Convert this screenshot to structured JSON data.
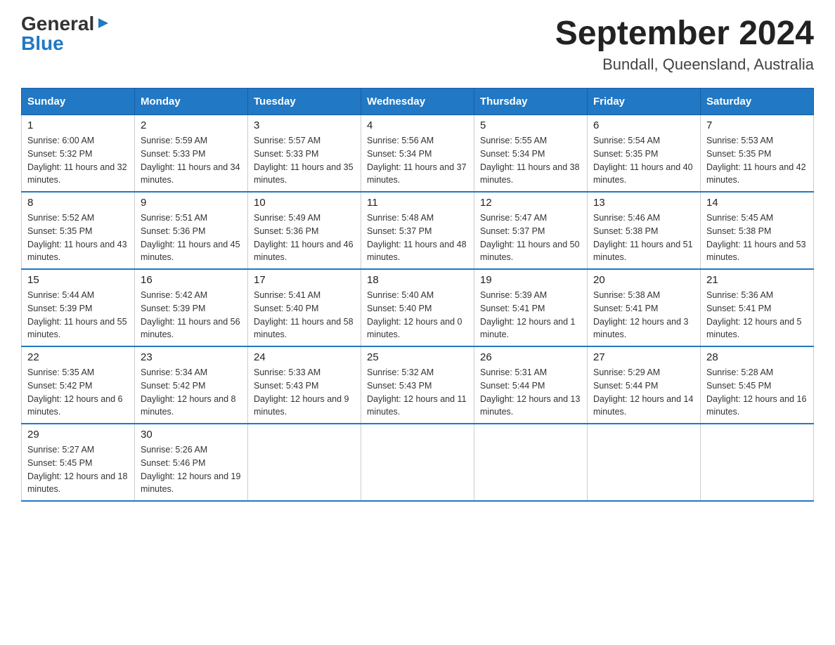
{
  "header": {
    "logo_general": "General",
    "logo_blue": "Blue",
    "month_title": "September 2024",
    "location": "Bundall, Queensland, Australia"
  },
  "days_of_week": [
    "Sunday",
    "Monday",
    "Tuesday",
    "Wednesday",
    "Thursday",
    "Friday",
    "Saturday"
  ],
  "weeks": [
    [
      {
        "day": "1",
        "sunrise": "6:00 AM",
        "sunset": "5:32 PM",
        "daylight": "11 hours and 32 minutes."
      },
      {
        "day": "2",
        "sunrise": "5:59 AM",
        "sunset": "5:33 PM",
        "daylight": "11 hours and 34 minutes."
      },
      {
        "day": "3",
        "sunrise": "5:57 AM",
        "sunset": "5:33 PM",
        "daylight": "11 hours and 35 minutes."
      },
      {
        "day": "4",
        "sunrise": "5:56 AM",
        "sunset": "5:34 PM",
        "daylight": "11 hours and 37 minutes."
      },
      {
        "day": "5",
        "sunrise": "5:55 AM",
        "sunset": "5:34 PM",
        "daylight": "11 hours and 38 minutes."
      },
      {
        "day": "6",
        "sunrise": "5:54 AM",
        "sunset": "5:35 PM",
        "daylight": "11 hours and 40 minutes."
      },
      {
        "day": "7",
        "sunrise": "5:53 AM",
        "sunset": "5:35 PM",
        "daylight": "11 hours and 42 minutes."
      }
    ],
    [
      {
        "day": "8",
        "sunrise": "5:52 AM",
        "sunset": "5:35 PM",
        "daylight": "11 hours and 43 minutes."
      },
      {
        "day": "9",
        "sunrise": "5:51 AM",
        "sunset": "5:36 PM",
        "daylight": "11 hours and 45 minutes."
      },
      {
        "day": "10",
        "sunrise": "5:49 AM",
        "sunset": "5:36 PM",
        "daylight": "11 hours and 46 minutes."
      },
      {
        "day": "11",
        "sunrise": "5:48 AM",
        "sunset": "5:37 PM",
        "daylight": "11 hours and 48 minutes."
      },
      {
        "day": "12",
        "sunrise": "5:47 AM",
        "sunset": "5:37 PM",
        "daylight": "11 hours and 50 minutes."
      },
      {
        "day": "13",
        "sunrise": "5:46 AM",
        "sunset": "5:38 PM",
        "daylight": "11 hours and 51 minutes."
      },
      {
        "day": "14",
        "sunrise": "5:45 AM",
        "sunset": "5:38 PM",
        "daylight": "11 hours and 53 minutes."
      }
    ],
    [
      {
        "day": "15",
        "sunrise": "5:44 AM",
        "sunset": "5:39 PM",
        "daylight": "11 hours and 55 minutes."
      },
      {
        "day": "16",
        "sunrise": "5:42 AM",
        "sunset": "5:39 PM",
        "daylight": "11 hours and 56 minutes."
      },
      {
        "day": "17",
        "sunrise": "5:41 AM",
        "sunset": "5:40 PM",
        "daylight": "11 hours and 58 minutes."
      },
      {
        "day": "18",
        "sunrise": "5:40 AM",
        "sunset": "5:40 PM",
        "daylight": "12 hours and 0 minutes."
      },
      {
        "day": "19",
        "sunrise": "5:39 AM",
        "sunset": "5:41 PM",
        "daylight": "12 hours and 1 minute."
      },
      {
        "day": "20",
        "sunrise": "5:38 AM",
        "sunset": "5:41 PM",
        "daylight": "12 hours and 3 minutes."
      },
      {
        "day": "21",
        "sunrise": "5:36 AM",
        "sunset": "5:41 PM",
        "daylight": "12 hours and 5 minutes."
      }
    ],
    [
      {
        "day": "22",
        "sunrise": "5:35 AM",
        "sunset": "5:42 PM",
        "daylight": "12 hours and 6 minutes."
      },
      {
        "day": "23",
        "sunrise": "5:34 AM",
        "sunset": "5:42 PM",
        "daylight": "12 hours and 8 minutes."
      },
      {
        "day": "24",
        "sunrise": "5:33 AM",
        "sunset": "5:43 PM",
        "daylight": "12 hours and 9 minutes."
      },
      {
        "day": "25",
        "sunrise": "5:32 AM",
        "sunset": "5:43 PM",
        "daylight": "12 hours and 11 minutes."
      },
      {
        "day": "26",
        "sunrise": "5:31 AM",
        "sunset": "5:44 PM",
        "daylight": "12 hours and 13 minutes."
      },
      {
        "day": "27",
        "sunrise": "5:29 AM",
        "sunset": "5:44 PM",
        "daylight": "12 hours and 14 minutes."
      },
      {
        "day": "28",
        "sunrise": "5:28 AM",
        "sunset": "5:45 PM",
        "daylight": "12 hours and 16 minutes."
      }
    ],
    [
      {
        "day": "29",
        "sunrise": "5:27 AM",
        "sunset": "5:45 PM",
        "daylight": "12 hours and 18 minutes."
      },
      {
        "day": "30",
        "sunrise": "5:26 AM",
        "sunset": "5:46 PM",
        "daylight": "12 hours and 19 minutes."
      },
      null,
      null,
      null,
      null,
      null
    ]
  ]
}
